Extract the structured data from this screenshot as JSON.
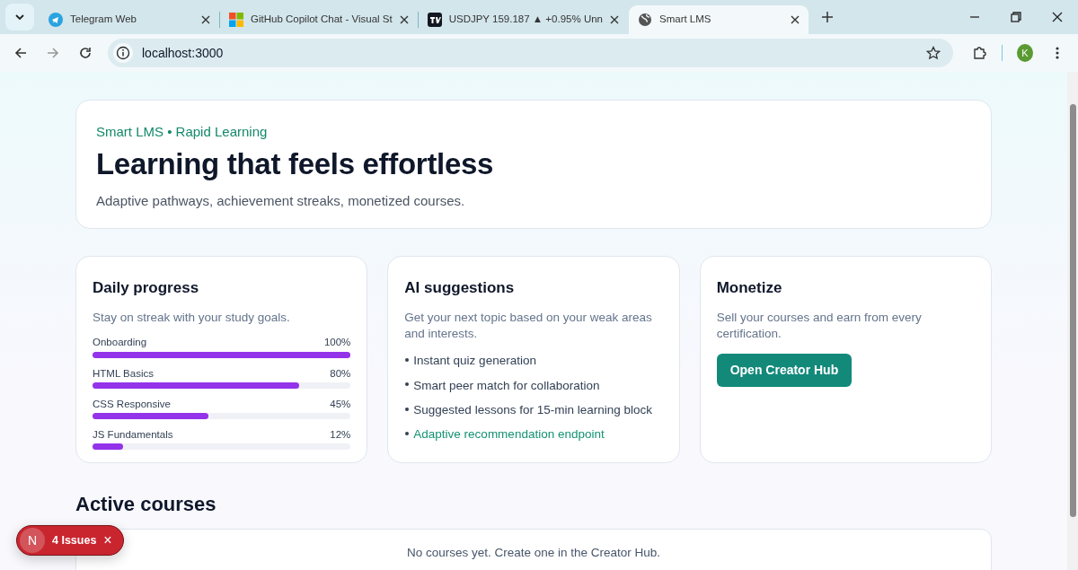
{
  "browser": {
    "tabs": [
      {
        "title": "Telegram Web",
        "selected": false
      },
      {
        "title": "GitHub Copilot Chat - Visual St",
        "selected": false
      },
      {
        "title": "USDJPY 159.187 ▲ +0.95% Unn",
        "selected": false
      },
      {
        "title": "Smart LMS",
        "selected": true
      }
    ],
    "address": "localhost:3000",
    "profile": "K"
  },
  "hero": {
    "eyebrow": "Smart LMS • Rapid Learning",
    "title": "Learning that feels effortless",
    "subtitle": "Adaptive pathways, achievement streaks, monetized courses."
  },
  "cards": [
    {
      "kind": "progress",
      "title": "Daily progress",
      "description": "Stay on streak with your study goals.",
      "items": [
        {
          "label": "Onboarding",
          "reading": "100%",
          "level": 1
        },
        {
          "label": "HTML Basics",
          "reading": "80%",
          "level": 0.8
        },
        {
          "label": "CSS Responsive",
          "reading": "45%",
          "level": 0.45
        },
        {
          "label": "JS Fundamentals",
          "reading": "12%",
          "level": 0.12
        }
      ]
    },
    {
      "kind": "list",
      "title": "AI suggestions",
      "description": "Get your next topic based on your weak areas and interests.",
      "items": [
        {
          "text": "Instant quiz generation",
          "kind": "text"
        },
        {
          "text": "Smart peer match for collaboration",
          "kind": "text"
        },
        {
          "text": "Suggested lessons for 15-min learning block",
          "kind": "text"
        },
        {
          "text": "Adaptive recommendation endpoint",
          "kind": "link"
        }
      ]
    },
    {
      "kind": "action",
      "title": "Monetize",
      "description": "Sell your courses and earn from every certification.",
      "button": "Open Creator Hub"
    }
  ],
  "active_courses": {
    "heading": "Active courses",
    "empty_message": "No courses yet. Create one in the Creator Hub."
  },
  "dev_badge": {
    "logo": "N",
    "label": "4 Issues",
    "close": "×"
  }
}
